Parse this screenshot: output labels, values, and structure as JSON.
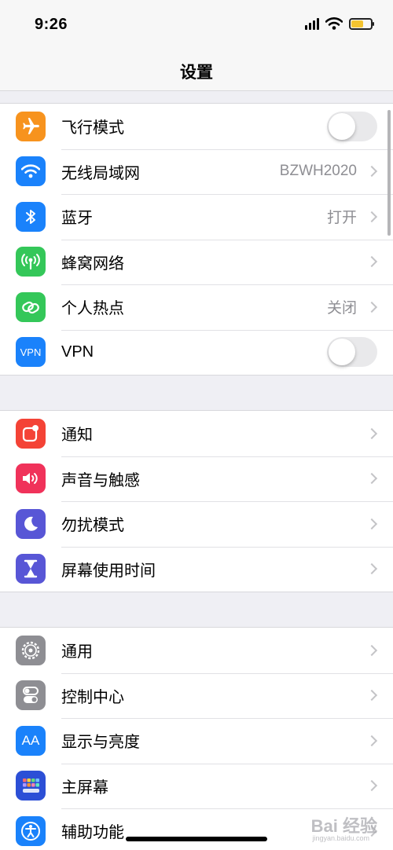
{
  "status_bar": {
    "time": "9:26",
    "icons": [
      "cellular-signal-icon",
      "wifi-icon",
      "battery-icon"
    ],
    "battery_color": "#f4c430",
    "battery_level": 0.62
  },
  "nav": {
    "title": "设置"
  },
  "groups": [
    {
      "items": [
        {
          "label": "飞行模式",
          "icon": "airplane-icon",
          "color": "#f7931e",
          "accessory": "toggle",
          "toggle_on": false
        },
        {
          "label": "无线局域网",
          "icon": "wifi-icon",
          "color": "#1a82fb",
          "accessory": "chevron",
          "value": "BZWH2020"
        },
        {
          "label": "蓝牙",
          "icon": "bluetooth-icon",
          "color": "#1a82fb",
          "accessory": "chevron",
          "value": "打开"
        },
        {
          "label": "蜂窝网络",
          "icon": "antenna-icon",
          "color": "#34c759",
          "accessory": "chevron"
        },
        {
          "label": "个人热点",
          "icon": "hotspot-link-icon",
          "color": "#34c759",
          "accessory": "chevron",
          "value": "关闭"
        },
        {
          "label": "VPN",
          "icon": "vpn-icon",
          "icon_text": "VPN",
          "color": "#1a82fb",
          "accessory": "toggle",
          "toggle_on": false
        }
      ]
    },
    {
      "items": [
        {
          "label": "通知",
          "icon": "notification-icon",
          "color": "#f44336",
          "accessory": "chevron"
        },
        {
          "label": "声音与触感",
          "icon": "speaker-icon",
          "color": "#f0325a",
          "accessory": "chevron"
        },
        {
          "label": "勿扰模式",
          "icon": "moon-icon",
          "color": "#5856d6",
          "accessory": "chevron"
        },
        {
          "label": "屏幕使用时间",
          "icon": "hourglass-icon",
          "color": "#5856d6",
          "accessory": "chevron"
        }
      ]
    },
    {
      "items": [
        {
          "label": "通用",
          "icon": "gear-icon",
          "color": "#8e8e93",
          "accessory": "chevron"
        },
        {
          "label": "控制中心",
          "icon": "switches-icon",
          "color": "#8e8e93",
          "accessory": "chevron"
        },
        {
          "label": "显示与亮度",
          "icon": "text-size-icon",
          "icon_text": "AA",
          "color": "#1a82fb",
          "accessory": "chevron"
        },
        {
          "label": "主屏幕",
          "icon": "home-screen-grid-icon",
          "color": "#2c4fd6",
          "accessory": "chevron"
        },
        {
          "label": "辅助功能",
          "icon": "accessibility-icon",
          "color": "#1a82fb",
          "accessory": "chevron"
        }
      ]
    }
  ],
  "watermark": {
    "text": "Bai 经验",
    "sub": "jingyan.baidu.com"
  }
}
